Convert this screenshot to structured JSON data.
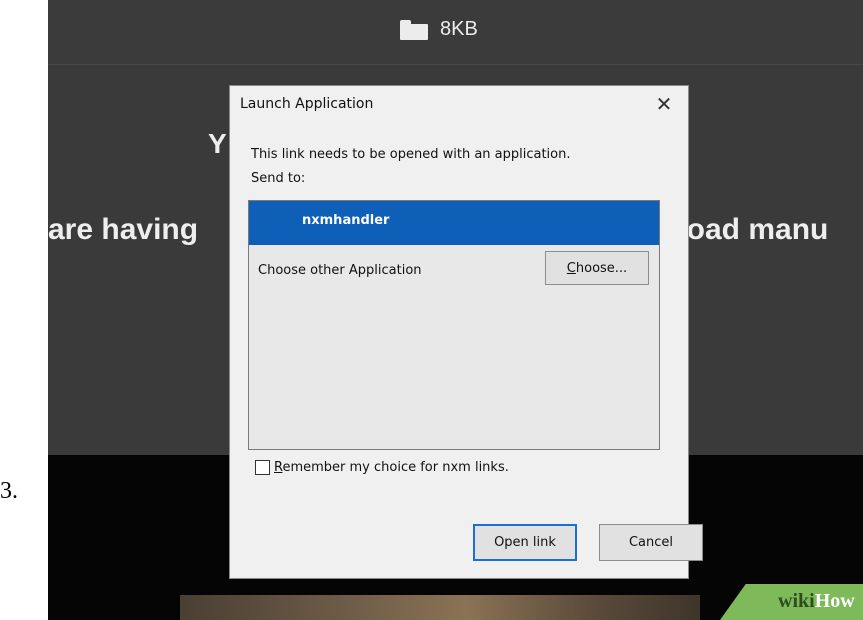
{
  "step_number": "3.",
  "window": {
    "title": "8KB"
  },
  "background": {
    "heading_fragment": "Y",
    "line_left": "are having",
    "line_right": "nload manu"
  },
  "dialog": {
    "title": "Launch Application",
    "message": "This link needs to be opened with an application.",
    "send_to_label": "Send to:",
    "selected_app": "nxmhandler",
    "other_app_label": "Choose other Application",
    "choose_button": {
      "mnemonic": "C",
      "rest": "hoose..."
    },
    "remember": {
      "checked": false,
      "mnemonic": "R",
      "rest": "emember my choice for nxm links."
    },
    "open_button": "Open link",
    "cancel_button": "Cancel"
  },
  "watermark": {
    "part1": "wiki",
    "part2": "How"
  },
  "colors": {
    "highlight": "#36ea17",
    "selection": "#0d5fb8",
    "background_dark": "#3a3a3a",
    "watermark": "#7eb95a"
  }
}
